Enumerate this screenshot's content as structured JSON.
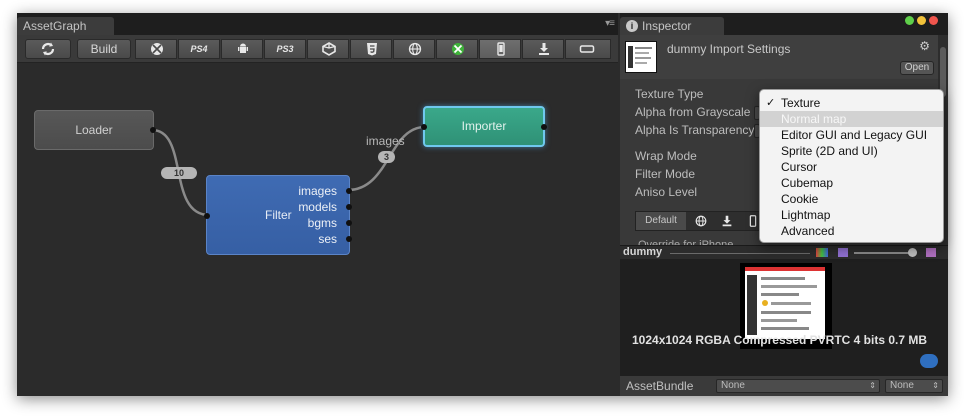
{
  "asset_graph": {
    "tab_title": "AssetGraph",
    "menu_glyph": "▾≡",
    "toolbar": {
      "refresh_icon": "refresh-icon",
      "build_label": "Build",
      "platforms": [
        {
          "icon": "xbox360-icon",
          "text": ""
        },
        {
          "icon": "ps4-icon",
          "text": "PS4"
        },
        {
          "icon": "android-icon",
          "text": ""
        },
        {
          "icon": "ps3-icon",
          "text": "PS3"
        },
        {
          "icon": "unity-icon",
          "text": ""
        },
        {
          "icon": "html5-icon",
          "text": ""
        },
        {
          "icon": "web-icon",
          "text": ""
        },
        {
          "icon": "xbox-one-icon",
          "text": ""
        },
        {
          "icon": "phone-icon",
          "text": ""
        },
        {
          "icon": "download-icon",
          "text": ""
        },
        {
          "icon": "tv-icon",
          "text": ""
        }
      ]
    },
    "nodes": {
      "loader": {
        "label": "Loader"
      },
      "filter": {
        "label": "Filter",
        "outputs": [
          "images",
          "models",
          "bgms",
          "ses"
        ]
      },
      "importer": {
        "label": "Importer"
      }
    },
    "edges": {
      "loader_to_filter_count": "10",
      "filter_to_importer_label": "images",
      "filter_to_importer_count": "3"
    },
    "colors": {
      "loader": "#505050",
      "filter": "#3a63aa",
      "importer": "#34a082",
      "selected_border": "#6fc8ee"
    }
  },
  "inspector": {
    "tab_title": "Inspector",
    "tab_icon": "i",
    "header_title": "dummy Import Settings",
    "open_label": "Open",
    "properties": [
      "Texture Type",
      "Alpha from Grayscale",
      "Alpha Is Transparency",
      "Wrap Mode",
      "Filter Mode",
      "Aniso Level"
    ],
    "platform_tab_default": "Default",
    "override_label": "Override for iPhone",
    "preview_name": "dummy",
    "preview_info": "1024x1024  RGBA Compressed PVRTC 4 bits   0.7 MB",
    "asset_bundle_label": "AssetBundle",
    "bundle_select": "None",
    "variant_select": "None"
  },
  "texture_type_dropdown": {
    "options": [
      "Texture",
      "Normal map",
      "Editor GUI and Legacy GUI",
      "Sprite (2D and UI)",
      "Cursor",
      "Cubemap",
      "Cookie",
      "Lightmap",
      "Advanced"
    ],
    "checked": "Texture",
    "highlighted": "Normal map",
    "check_glyph": "✓"
  }
}
